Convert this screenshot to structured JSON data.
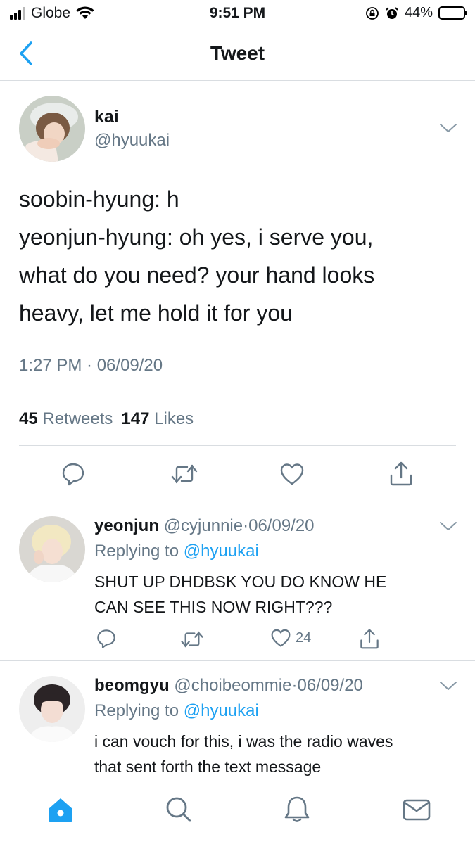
{
  "status_bar": {
    "carrier": "Globe",
    "time": "9:51 PM",
    "battery": "44%",
    "battery_level": 0.44,
    "icons": [
      "signal-icon",
      "wifi-icon",
      "orientation-lock-icon",
      "alarm-icon",
      "battery-icon"
    ]
  },
  "nav": {
    "title": "Tweet",
    "back_icon": "chevron-left-icon"
  },
  "tweet": {
    "name": "kai",
    "handle": "@hyuukai",
    "lines": [
      "soobin-hyung: h",
      "yeonjun-hyung: oh yes, i serve you,",
      "what do you need? your hand looks",
      "heavy, let me hold it for you"
    ],
    "timestamp": "1:27 PM · 06/09/20",
    "retweets_count": "45",
    "retweets_label": "Retweets",
    "likes_count": "147",
    "likes_label": "Likes",
    "actions": [
      "reply-icon",
      "retweet-icon",
      "like-icon",
      "share-icon"
    ]
  },
  "replies": [
    {
      "name": "yeonjun",
      "handle": "@cyjunnie",
      "date": "06/09/20",
      "replying_label": "Replying to",
      "replying_to": "@hyuukai",
      "lines": [
        "SHUT UP DHDBSK YOU DO KNOW HE",
        "CAN SEE THIS NOW RIGHT???"
      ],
      "like_count": "24"
    },
    {
      "name": "beomgyu",
      "handle": "@choibeommie",
      "date": "06/09/20",
      "replying_label": "Replying to",
      "replying_to": "@hyuukai",
      "lines": [
        "i can vouch for this, i was the radio waves",
        "that sent forth the text message"
      ]
    }
  ],
  "tabbar": {
    "items": [
      "home-icon",
      "search-icon",
      "notifications-icon",
      "messages-icon"
    ],
    "active": "home-icon",
    "accent": "#1da1f2"
  },
  "colors": {
    "accent": "#1da1f2",
    "secondary_text": "#657786",
    "divider": "#d9dde1"
  }
}
